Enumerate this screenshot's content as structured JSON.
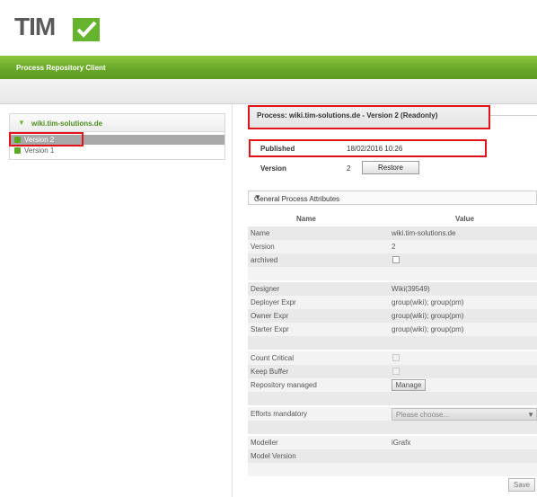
{
  "app": {
    "logo_text": "TIM",
    "subtitle": "Process Repository Client"
  },
  "tree": {
    "root_label": "wiki.tim-solutions.de",
    "items": [
      {
        "label": "Version 2",
        "selected": true
      },
      {
        "label": "Version 1",
        "selected": false
      }
    ]
  },
  "process": {
    "title": "Process: wiki.tim-solutions.de - Version 2 (Readonly)",
    "published_label": "Published",
    "published_value": "18/02/2016 10:26",
    "version_label": "Version",
    "version_value": "2",
    "restore_label": "Restore"
  },
  "section": {
    "title": "General Process Attributes"
  },
  "attributes": {
    "name_header": "Name",
    "value_header": "Value",
    "name": {
      "label": "Name",
      "value": "wiki.tim-solutions.de"
    },
    "version": {
      "label": "Version",
      "value": "2"
    },
    "archived": {
      "label": "archived"
    },
    "designer": {
      "label": "Designer",
      "value": "Wiki(39549)"
    },
    "deployer": {
      "label": "Deployer Expr",
      "value": "group(wiki); group(pm)"
    },
    "owner": {
      "label": "Owner Expr",
      "value": "group(wiki); group(pm)"
    },
    "starter": {
      "label": "Starter Expr",
      "value": "group(wiki); group(pm)"
    },
    "count_critical": {
      "label": "Count Critical"
    },
    "keep_buffer": {
      "label": "Keep Buffer"
    },
    "repository_managed": {
      "label": "Repository managed",
      "button": "Manage"
    },
    "efforts_mandatory": {
      "label": "Efforts mandatory",
      "placeholder": "Please choose..."
    },
    "modeller": {
      "label": "Modeller",
      "value": "iGrafx"
    },
    "model_version": {
      "label": "Model Version"
    }
  },
  "actions": {
    "save_label": "Save"
  },
  "colors": {
    "brand_green": "#6aa82a",
    "highlight_red": "#e0131b",
    "selection_gray": "#a8a8a8"
  }
}
